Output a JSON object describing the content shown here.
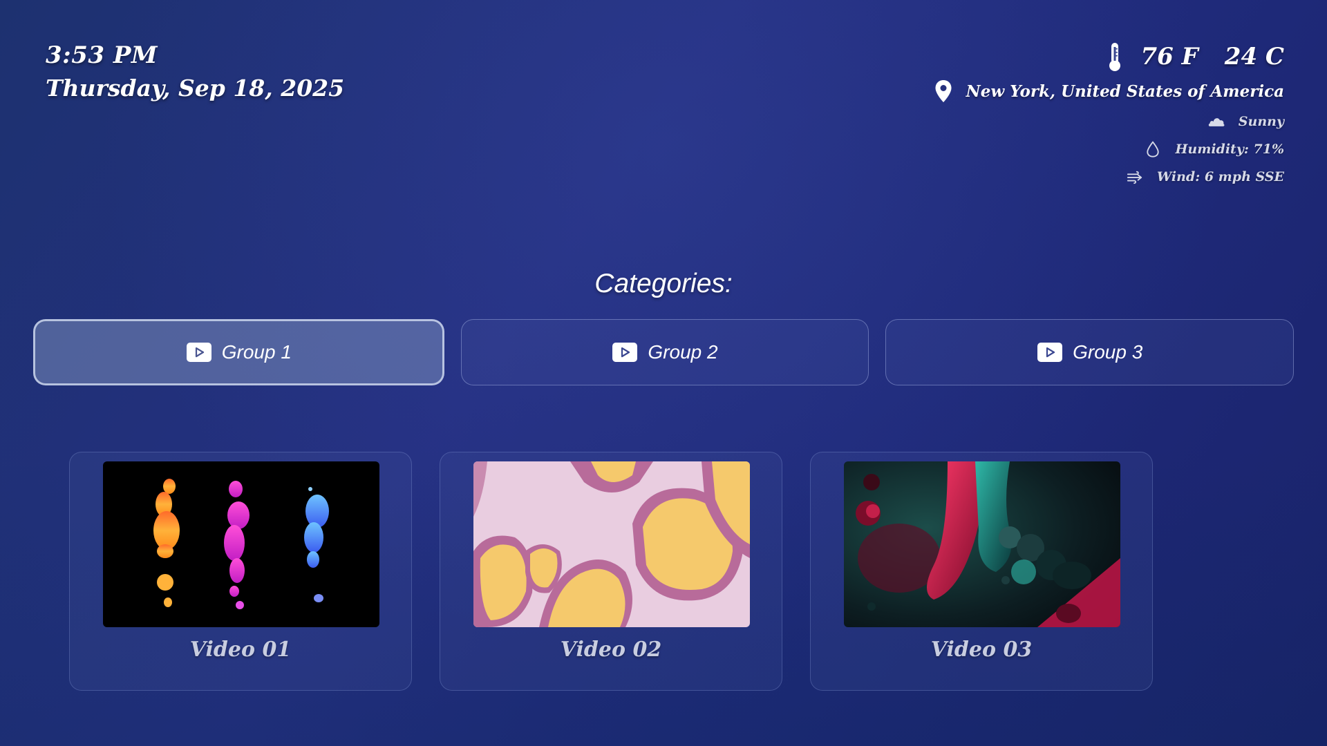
{
  "clock": {
    "time": "3:53 PM",
    "date": "Thursday, Sep 18, 2025"
  },
  "weather": {
    "temp_f": "76 F",
    "temp_c": "24 C",
    "location": "New York, United States of America",
    "condition": "Sunny",
    "humidity": "Humidity: 71%",
    "wind": "Wind: 6 mph SSE",
    "icons": {
      "temperature": "thermometer-icon",
      "location": "map-pin-icon",
      "condition": "cloud-icon",
      "humidity": "droplet-icon",
      "wind": "wind-icon"
    }
  },
  "categories": {
    "title": "Categories:",
    "active_index": 0,
    "groups": [
      {
        "label": "Group 1",
        "icon": "play-icon"
      },
      {
        "label": "Group 2",
        "icon": "play-icon"
      },
      {
        "label": "Group 3",
        "icon": "play-icon"
      }
    ]
  },
  "videos": [
    {
      "title": "Video 01",
      "thumbnail": "colorful liquid drips on black"
    },
    {
      "title": "Video 02",
      "thumbnail": "yellow cells on pink"
    },
    {
      "title": "Video 03",
      "thumbnail": "red and teal blobs"
    }
  ],
  "colors": {
    "background": "#232f7c",
    "active_button": "#6a7ab0",
    "text": "#ffffff",
    "muted_text": "#c8cde0"
  }
}
